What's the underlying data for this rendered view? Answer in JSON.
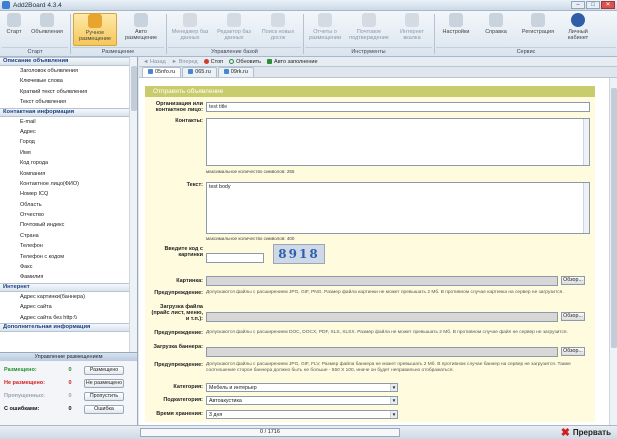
{
  "window": {
    "title": "Add2Board 4.3.4"
  },
  "ribbon": {
    "buttons": [
      {
        "label": "Старт"
      },
      {
        "label": "Объявления"
      },
      {
        "label": "Ручное размещение"
      },
      {
        "label": "Авто размещение"
      },
      {
        "label": "Менеджер баз данных"
      },
      {
        "label": "Редактор баз данных"
      },
      {
        "label": "Поиск новых досок"
      },
      {
        "label": "Отчеты о размещении"
      },
      {
        "label": "Почтовое подтверждение"
      },
      {
        "label": "Интернет вкалка"
      },
      {
        "label": "Настройки"
      },
      {
        "label": "Справка"
      },
      {
        "label": "Регистрация"
      },
      {
        "label": "Личный кабинет"
      }
    ],
    "groups": [
      "Старт",
      "Размещение",
      "Управление базой",
      "Инструменты",
      "Сервис"
    ]
  },
  "sidebar": {
    "sections": [
      {
        "title": "Описание объявления",
        "items": [
          "Заголовок объявления",
          "Ключевые слова",
          "Краткий текст объявления",
          "Текст объявления"
        ]
      },
      {
        "title": "Контактная информация",
        "items": [
          "E-mail",
          "Адрес",
          "Город",
          "Имя",
          "Код города",
          "Компания",
          "Контактное лицо(ФИО)",
          "Номер ICQ",
          "Область",
          "Отчество",
          "Почтовый индекс",
          "Страна",
          "Телефон",
          "Телефон с кодом",
          "Факс",
          "Фамилия"
        ]
      },
      {
        "title": "Интернет",
        "items": [
          "Адрес картинки(баннера)",
          "Адрес сайта",
          "Адрес сайта без http:\\\\"
        ]
      },
      {
        "title": "Дополнительная информация",
        "items": []
      }
    ]
  },
  "status": {
    "header": "Управление размещением",
    "rows": [
      {
        "label": "Размещено:",
        "count": "0",
        "button": "Размещено",
        "color": "#1f8f2a"
      },
      {
        "label": "Не размещено:",
        "count": "0",
        "button": "Не размещено",
        "color": "#d21d1d"
      },
      {
        "label": "Пропущенных:",
        "count": "0",
        "button": "Пропустить",
        "color": "#9aa3ad"
      },
      {
        "label": "С ошибками:",
        "count": "0",
        "button": "Ошибка",
        "color": "#111111"
      }
    ]
  },
  "nav": {
    "back": "Назад",
    "forward": "Вперед",
    "stop": "Стоп",
    "refresh": "Обновить",
    "autofill": "Авто заполнение"
  },
  "tabs": [
    "05nfo.ru",
    "065.ru",
    "09rk.ru"
  ],
  "form": {
    "header": "Отправить объявление",
    "org_label": "Организация или контактное лицо:",
    "org_value": "test title",
    "contacts_label": "Контакты:",
    "contacts_hint": "максимальное количество символов: 255",
    "text_label": "Текст:",
    "text_value": "test body",
    "text_hint": "максимальное количество символов: 400",
    "captcha_label": "Введите код с картинки",
    "captcha_text": "8918",
    "image_label": "Картинка:",
    "browse": "Обзор...",
    "warn_label": "Предупреждение:",
    "warn1": "Допускаются файлы с расширением JPG, GIF, PNG. Размер файла картинки не может превышать 2 Мб. В противном случае картинка на сервер не загрузится.",
    "file_label": "Загрузка файла (прайс лист, меню, и т.п.):",
    "warn2": "Допускаются файлы с расширением DOC, DOCX, PDF, XLS, XLSX. Размер файла не может превышать 2 Мб. В противном случае файл не сервер не загрузится.",
    "banner_label": "Загрузка баннера:",
    "warn3": "Допускаются файлы с расширением JPG, GIF, FLV. Размер файла баннера не может превышать 2 Мб. В противном случае баннер на сервер не загрузится. Также соотношение сторон баннера должно быть не больше - 550 Х 100, иначе он будет неправильно отображаться.",
    "category_label": "Категория:",
    "category_value": "Мебель и интерьер",
    "subcategory_label": "Подкатегория:",
    "subcategory_value": "Автоакустика",
    "storage_label": "Время хранения:",
    "storage_value": "3 дня"
  },
  "bottom": {
    "progress": "0 / 1716",
    "stop": "Прервать"
  }
}
